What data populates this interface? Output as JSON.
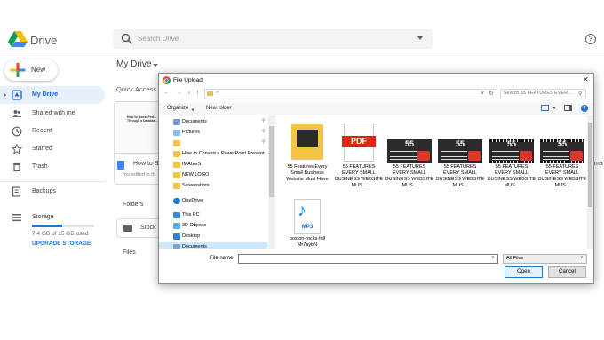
{
  "drive": {
    "app_name": "Drive",
    "search_placeholder": "Search Drive",
    "help_glyph": "?",
    "new_label": "New",
    "nav": {
      "my_drive": "My Drive",
      "shared": "Shared with me",
      "recent": "Recent",
      "starred": "Starred",
      "trash": "Trash",
      "backups": "Backups",
      "storage": "Storage"
    },
    "storage_used": "7.4 GB of 15 GB used",
    "storage_fraction": 0.49,
    "upgrade": "UPGRADE STORAGE",
    "main_title": "My Drive",
    "quick_access": "Quick Access",
    "qa_card": {
      "thumb_text": "How to Boost Perf... Through a Databas...",
      "name": "How to Bo",
      "subtitle": "You edited in th"
    },
    "right_edge_text": "ma",
    "folders_title": "Folders",
    "folder_name": "Stock P",
    "files_title": "Files"
  },
  "dialog": {
    "title": "File Upload",
    "close_glyph": "✕",
    "search_placeholder": "Search 55 FEATURES EVERY S...",
    "organize": "Organize",
    "new_folder": "New folder",
    "help_glyph": "?",
    "tree": [
      {
        "label": "Documents",
        "icon": "documents-icon",
        "pinned": true
      },
      {
        "label": "Pictures",
        "icon": "pictures-icon",
        "pinned": true
      },
      {
        "label": "",
        "icon": "folder-icon",
        "pinned": true
      },
      {
        "label": "How to Convert a PowerPoint Present",
        "icon": "folder-icon",
        "pinned": false
      },
      {
        "label": "IMAGES",
        "icon": "folder-icon",
        "pinned": false
      },
      {
        "label": "NEW LOGO",
        "icon": "folder-icon",
        "pinned": false
      },
      {
        "label": "Screenshots",
        "icon": "folder-icon",
        "pinned": false
      },
      {
        "label": "OneDrive",
        "icon": "onedrive-icon",
        "pinned": false
      },
      {
        "label": "This PC",
        "icon": "this-pc-icon",
        "pinned": false
      },
      {
        "label": "3D Objects",
        "icon": "3d-objects-icon",
        "pinned": false
      },
      {
        "label": "Desktop",
        "icon": "desktop-icon",
        "pinned": false
      },
      {
        "label": "Documents",
        "icon": "documents-icon",
        "pinned": false
      }
    ],
    "files": [
      {
        "caption": "55 Features Every Small Business Website Must Have",
        "kind": "folder"
      },
      {
        "caption": "55 FEATURES EVERY SMALL BUSINESS WEBSITE MUS...",
        "kind": "pdf",
        "badge": "PDF"
      },
      {
        "caption": "55 FEATURES EVERY SMALL BUSINESS WEBSITE MUS...",
        "kind": "image",
        "number": "55"
      },
      {
        "caption": "55 FEATURES EVERY SMALL BUSINESS WEBSITE MUS...",
        "kind": "image",
        "number": "55"
      },
      {
        "caption": "55 FEATURES EVERY SMALL BUSINESS WEBSITE MUS...",
        "kind": "video",
        "number": "55"
      },
      {
        "caption": "55 FEATURES EVERY SMALL BUSINESS WEBSITE MUS...",
        "kind": "video",
        "number": "55"
      },
      {
        "caption": "boston-rocks-full Mr7aybN",
        "kind": "mp3",
        "badge": "MP3"
      }
    ],
    "file_name_label": "File name:",
    "file_name_value": "",
    "file_type": "All Files",
    "open": "Open",
    "cancel": "Cancel"
  }
}
